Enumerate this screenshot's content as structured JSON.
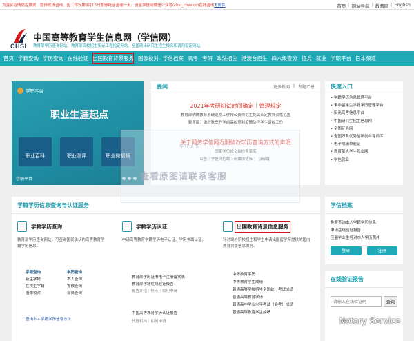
{
  "topbar": {
    "notice": "为落实疫情防控要求，暂停现场咨询。因工作安排9月15日暂停电话咨询一天。请至学信网微信公众号(chsi_chesicc)在线咨询",
    "notice_link": "发邮件",
    "links": [
      "首页",
      "网站导航",
      "教育网",
      "English"
    ]
  },
  "header": {
    "logo_text": "CHSI",
    "title": "中国高等教育学生信息网（学信网）",
    "subtitle": "教育部学历查询网站、教育部高校招生阳光工程指定网站、全国硕士研究生招生报名和调剂指定网站"
  },
  "nav": {
    "items": [
      "首页",
      "学籍查询",
      "学历查询",
      "在线验证",
      "出国教育背景服务",
      "图像校对",
      "学信档案",
      "高考",
      "考研",
      "政法招生",
      "港澳台招生",
      "四六级查分",
      "征兵",
      "就业",
      "学职平台",
      "日本频道"
    ],
    "highlighted": 4
  },
  "banner": {
    "logo": "学职平台",
    "title": "职业生涯起点",
    "tiles": [
      "职业百科",
      "职业测评",
      "职业微视频"
    ],
    "footer": "学职平台"
  },
  "news": {
    "title": "要闻",
    "more": "更多新闻",
    "special": "专题汇总",
    "headline1": "2021年考研初试时间确定｜管理规定",
    "line1": "教育部明确教育系统巡视工作和公费师范生免试认定教师资格范围",
    "line1b": "教育部：做好秋季开学前高校应对疫情防控学生返校工作",
    "headline2": "关于网传学信网近期修改学历查询方式的声明",
    "line2": "国家学位论文抽检专家库",
    "line3": "公告｜学信网招聘｜新媒体矩阵｜【新闻】"
  },
  "quick": {
    "title": "快速入口",
    "items": [
      "学籍学历信息管理平台",
      "来华留学生学籍学历管理平台",
      "阳光高考信息平台",
      "中国研究生招生信息网",
      "全国征兵网",
      "全国万名优秀创新创业导师库",
      "电子成绩单验证",
      "教育部大学生就业网",
      "学信就业"
    ]
  },
  "services": {
    "title": "学籍学历信息查询与认证服务",
    "col1": {
      "title": "学籍学历查询",
      "desc": "教育部学历查询网站，可查询国家承认的高等教育学籍学历信息。",
      "h1": "学籍查询",
      "h2": "学历查询",
      "items": [
        "新生学籍",
        "本人查询",
        "在校生学籍",
        "零散查询",
        "图像校对",
        "会员查询"
      ],
      "foot": "查询本人学籍学历信息方法"
    },
    "col2": {
      "title": "学籍学历认证",
      "desc": "申请高等教育学籍学历电子认证、学历书面认证。",
      "block1": "教育部学历证书电子注册备案表",
      "block1b": "教育部学籍在线验证报告",
      "links1": "报告介绍｜特点｜如何申请",
      "block2": "中国高等教育学历认证报告",
      "links2": "代理机构｜如何申请"
    },
    "col3": {
      "title": "出国教育背景信息服务",
      "desc": "针对境外院校招生和学生申请出国留学所提供的国内教育背景信息服务。",
      "items": [
        "中等教育学历",
        "中等教育学生成绩",
        "普通高等学校招生全国统一考试成绩",
        "普通高等教育学历",
        "普通高中学业水平考试（会考）成绩",
        "普通高等教育学生成绩"
      ]
    }
  },
  "archive": {
    "title": "学信档案",
    "lines": [
      "免费查询本人学籍学历信息",
      "申请在线验证报告",
      "应届毕业生可对本人学历照片"
    ],
    "login": "登录",
    "register": "注册"
  },
  "verify": {
    "title": "在线验证报告",
    "placeholder": "请输入在线验证码",
    "button": "查询"
  },
  "watermark": {
    "main": "查看原图请联系客服",
    "sub": "毕业证书",
    "corner": "Notary Service"
  },
  "colors": {
    "accent": "#1fa8b6",
    "alert": "#e03c31",
    "highlight_box": "#d71515"
  }
}
